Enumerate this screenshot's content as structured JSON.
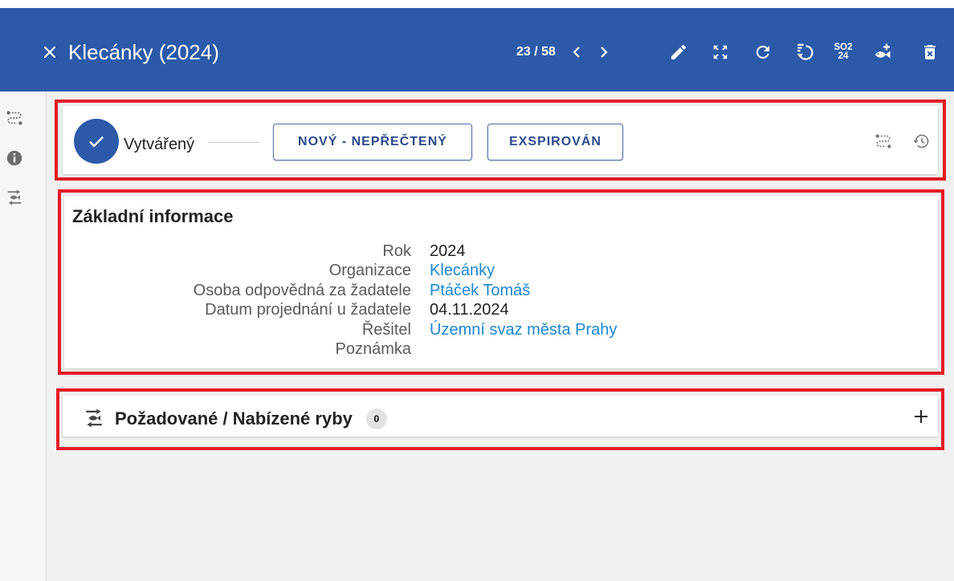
{
  "theme": {
    "primary": "#2c5aa8",
    "link": "#1b87d2",
    "annotation": "#e31b23"
  },
  "header": {
    "title": "Klecánky (2024)",
    "close_icon": "close-icon",
    "counter": "23 / 58",
    "prev_icon": "chevron-left-icon",
    "next_icon": "chevron-right-icon",
    "actions": {
      "edit": "pencil-icon",
      "fullscreen": "zoom-out-map-icon",
      "refresh": "refresh-icon",
      "history": "restore-list-icon",
      "so2": {
        "icon": "so2-icon",
        "line1": "SO2",
        "line2": "24"
      },
      "add_fish": "fish-add-icon",
      "delete": "delete-forever-icon"
    }
  },
  "sidebar": {
    "items": [
      {
        "icon": "workflow-icon"
      },
      {
        "icon": "info-icon"
      },
      {
        "icon": "fish-exchange-icon"
      }
    ]
  },
  "status": {
    "current_state": "Vytvářený",
    "current_icon": "check-icon",
    "transitions": [
      "NOVÝ - NEPŘEČTENÝ",
      "EXSPIROVÁN"
    ],
    "tools": [
      "workflow-icon",
      "history-icon"
    ]
  },
  "basic_info": {
    "title": "Základní informace",
    "fields": [
      {
        "label": "Rok",
        "value": "2024",
        "link": false
      },
      {
        "label": "Organizace",
        "value": "Klecánky",
        "link": true
      },
      {
        "label": "Osoba odpovědná za žadatele",
        "value": "Ptáček Tomáš",
        "link": true
      },
      {
        "label": "Datum projednání u žadatele",
        "value": "04.11.2024",
        "link": false
      },
      {
        "label": "Řešitel",
        "value": "Územní svaz města Prahy",
        "link": true
      },
      {
        "label": "Poznámka",
        "value": "",
        "link": false
      }
    ]
  },
  "fish_section": {
    "icon": "fish-exchange-icon",
    "title": "Požadované / Nabízené ryby",
    "count": "0",
    "add_icon": "plus-icon"
  }
}
